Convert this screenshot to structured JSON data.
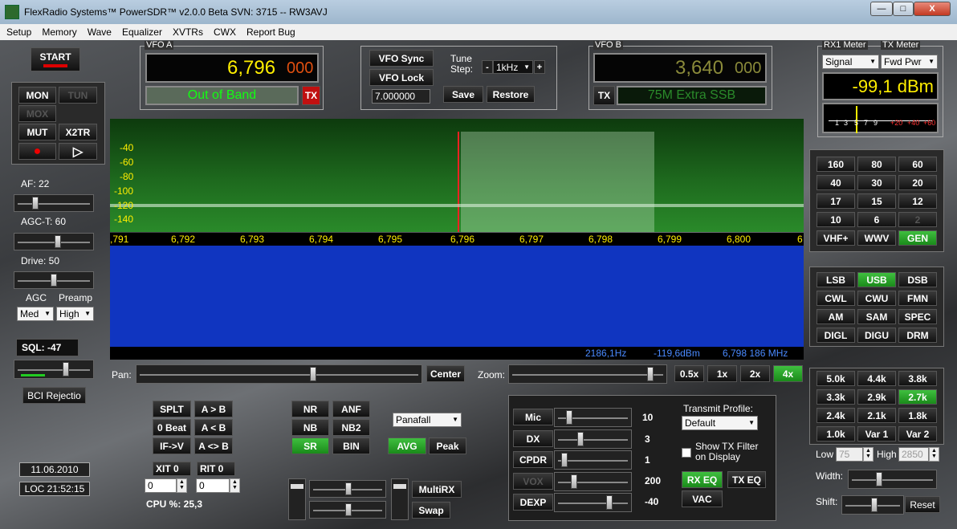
{
  "window": {
    "title": "FlexRadio Systems™  PowerSDR™  v2.0.0 Beta  SVN: 3715   --   RW3AVJ",
    "minimize": "—",
    "maximize": "□",
    "close": "X"
  },
  "menu": [
    "Setup",
    "Memory",
    "Wave",
    "Equalizer",
    "XVTRs",
    "CWX",
    "Report Bug"
  ],
  "start_label": "START",
  "left": {
    "mon": "MON",
    "tun": "TUN",
    "mox": "MOX",
    "mut": "MUT",
    "x2tr": "X2TR",
    "rec": "●",
    "play": "▷",
    "af_label": "AF:  22",
    "agct_label": "AGC-T:  60",
    "drive_label": "Drive:  50",
    "agc_label": "AGC",
    "preamp_label": "Preamp",
    "agc_value": "Med",
    "preamp_value": "High",
    "sql_label": "SQL:  -47",
    "bci_label": "BCI Rejectio",
    "date": "11.06.2010",
    "time": "LOC 21:52:15"
  },
  "vfoa": {
    "legend": "VFO A",
    "freq_main": "6,796",
    "freq_sub": "000",
    "band": "Out of Band",
    "tx": "TX"
  },
  "vfoctl": {
    "sync": "VFO Sync",
    "lock": "VFO Lock",
    "tune_label": "Tune\nStep:",
    "tune_minus": "-",
    "tune_value": "1kHz",
    "tune_plus": "+",
    "mem_value": "7.000000",
    "save": "Save",
    "restore": "Restore"
  },
  "vfob": {
    "legend": "VFO B",
    "freq_main": "3,640",
    "freq_sub": "000",
    "band": "75M Extra SSB",
    "tx": "TX"
  },
  "meter": {
    "rx_legend": "RX1 Meter",
    "tx_legend": "TX Meter",
    "rx_select": "Signal",
    "tx_select": "Fwd Pwr",
    "reading": "-99,1 dBm",
    "scale": [
      "1",
      "3",
      "5",
      "7",
      "9",
      "+20",
      "+40",
      "+60"
    ]
  },
  "freq_axis": [
    ",791",
    "6,792",
    "6,793",
    "6,794",
    "6,795",
    "6,796",
    "6,797",
    "6,798",
    "6,799",
    "6,800",
    "6"
  ],
  "dbm_axis": [
    "-40",
    "-60",
    "-80",
    "-100",
    "-120",
    "-140"
  ],
  "readout": {
    "hz": "2186,1Hz",
    "dbm": "-119,6dBm",
    "mhz": "6,798 186 MHz"
  },
  "pan_label": "Pan:",
  "center": "Center",
  "zoom_label": "Zoom:",
  "zoom": [
    "0.5x",
    "1x",
    "2x",
    "4x"
  ],
  "bands": [
    "160",
    "80",
    "60",
    "40",
    "30",
    "20",
    "17",
    "15",
    "12",
    "10",
    "6",
    "2",
    "VHF+",
    "WWV",
    "GEN"
  ],
  "modes": [
    "LSB",
    "USB",
    "DSB",
    "CWL",
    "CWU",
    "FMN",
    "AM",
    "SAM",
    "SPEC",
    "DIGL",
    "DIGU",
    "DRM"
  ],
  "filters": [
    "5.0k",
    "4.4k",
    "3.8k",
    "3.3k",
    "2.9k",
    "2.7k",
    "2.4k",
    "2.1k",
    "1.8k",
    "1.0k",
    "Var 1",
    "Var 2"
  ],
  "filter_ctl": {
    "low_label": "Low",
    "low_value": "75",
    "high_label": "High",
    "high_value": "2850",
    "width_label": "Width:",
    "shift_label": "Shift:",
    "reset": "Reset"
  },
  "split": {
    "splt": "SPLT",
    "atob": "A > B",
    "zerobeat": "0 Beat",
    "altb": "A < B",
    "ifv": "IF->V",
    "aswap": "A <> B",
    "xit_label": "XIT  0",
    "rit_label": "RIT  0",
    "xit_value": "0",
    "rit_value": "0",
    "cpu": "CPU %:  25,3"
  },
  "dsp": {
    "nr": "NR",
    "anf": "ANF",
    "nb": "NB",
    "nb2": "NB2",
    "sr": "SR",
    "bin": "BIN"
  },
  "display": {
    "mode": "Panafall",
    "avg": "AVG",
    "peak": "Peak"
  },
  "multirx": "MultiRX",
  "swap": "Swap",
  "tx": {
    "mic": "Mic",
    "mic_val": "10",
    "dx": "DX",
    "dx_val": "3",
    "cpdr": "CPDR",
    "cpdr_val": "1",
    "vox": "VOX",
    "vox_val": "200",
    "dexp": "DEXP",
    "dexp_val": "-40",
    "profile_label": "Transmit Profile:",
    "profile": "Default",
    "show_filter": "Show TX Filter\non Display",
    "rxeq": "RX EQ",
    "txeq": "TX EQ",
    "vac": "VAC"
  }
}
